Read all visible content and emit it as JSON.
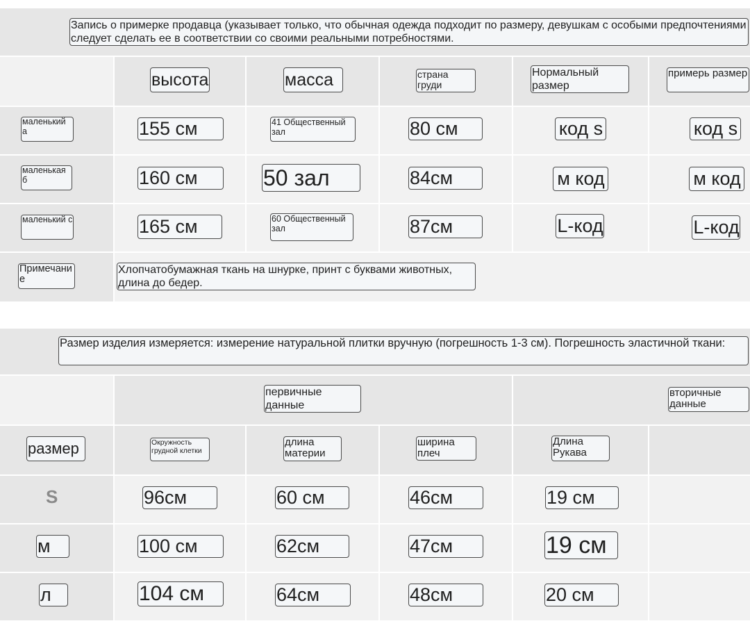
{
  "table1": {
    "note": "Запись о примерке продавца (указывает только, что обычная одежда подходит по размеру, девушкам с особыми предпочтениями следует сделать ее в соответствии со своими реальными потребностями.",
    "headers": [
      "высота",
      "масса",
      "страна груди",
      "Нормальный размер",
      "примерь размер"
    ],
    "rows": [
      {
        "label": "маленький а",
        "cells": [
          "155 см",
          "41 Общественный зал",
          "80 см",
          "код s",
          "код s"
        ]
      },
      {
        "label": "маленькая б",
        "cells": [
          "160 см",
          "50 зал",
          "84см",
          "м код",
          "м код"
        ]
      },
      {
        "label": "маленький с",
        "cells": [
          "165 см",
          "60 Общественный зал",
          "87см",
          "L-код",
          "L-код"
        ]
      }
    ],
    "remark_label": "Примечание",
    "remark_text": "Хлопчатобумажная ткань на шнурке, принт с буквами животных, длина до бедер."
  },
  "table2": {
    "note": "Размер изделия измеряется: измерение натуральной плитки вручную (погрешность 1-3 см). Погрешность эластичной ткани:",
    "group_primary": "первичные данные",
    "group_secondary": "вторичные данные",
    "size_header": "размер",
    "headers": [
      "Окружность грудной клетки",
      "длина материи",
      "ширина плеч",
      "Длина Рукава"
    ],
    "rows": [
      {
        "label": "S",
        "cells": [
          "96см",
          "60 см",
          "46см",
          "19 см"
        ]
      },
      {
        "label": "м",
        "cells": [
          "100 см",
          "62см",
          "47см",
          "19 см"
        ]
      },
      {
        "label": "л",
        "cells": [
          "104 см",
          "64см",
          "48см",
          "20 см"
        ]
      }
    ]
  },
  "colors": {
    "cell_dark": "#e6e6e6",
    "cell_light": "#f2f2f2",
    "box_border": "#4a4a4a"
  }
}
